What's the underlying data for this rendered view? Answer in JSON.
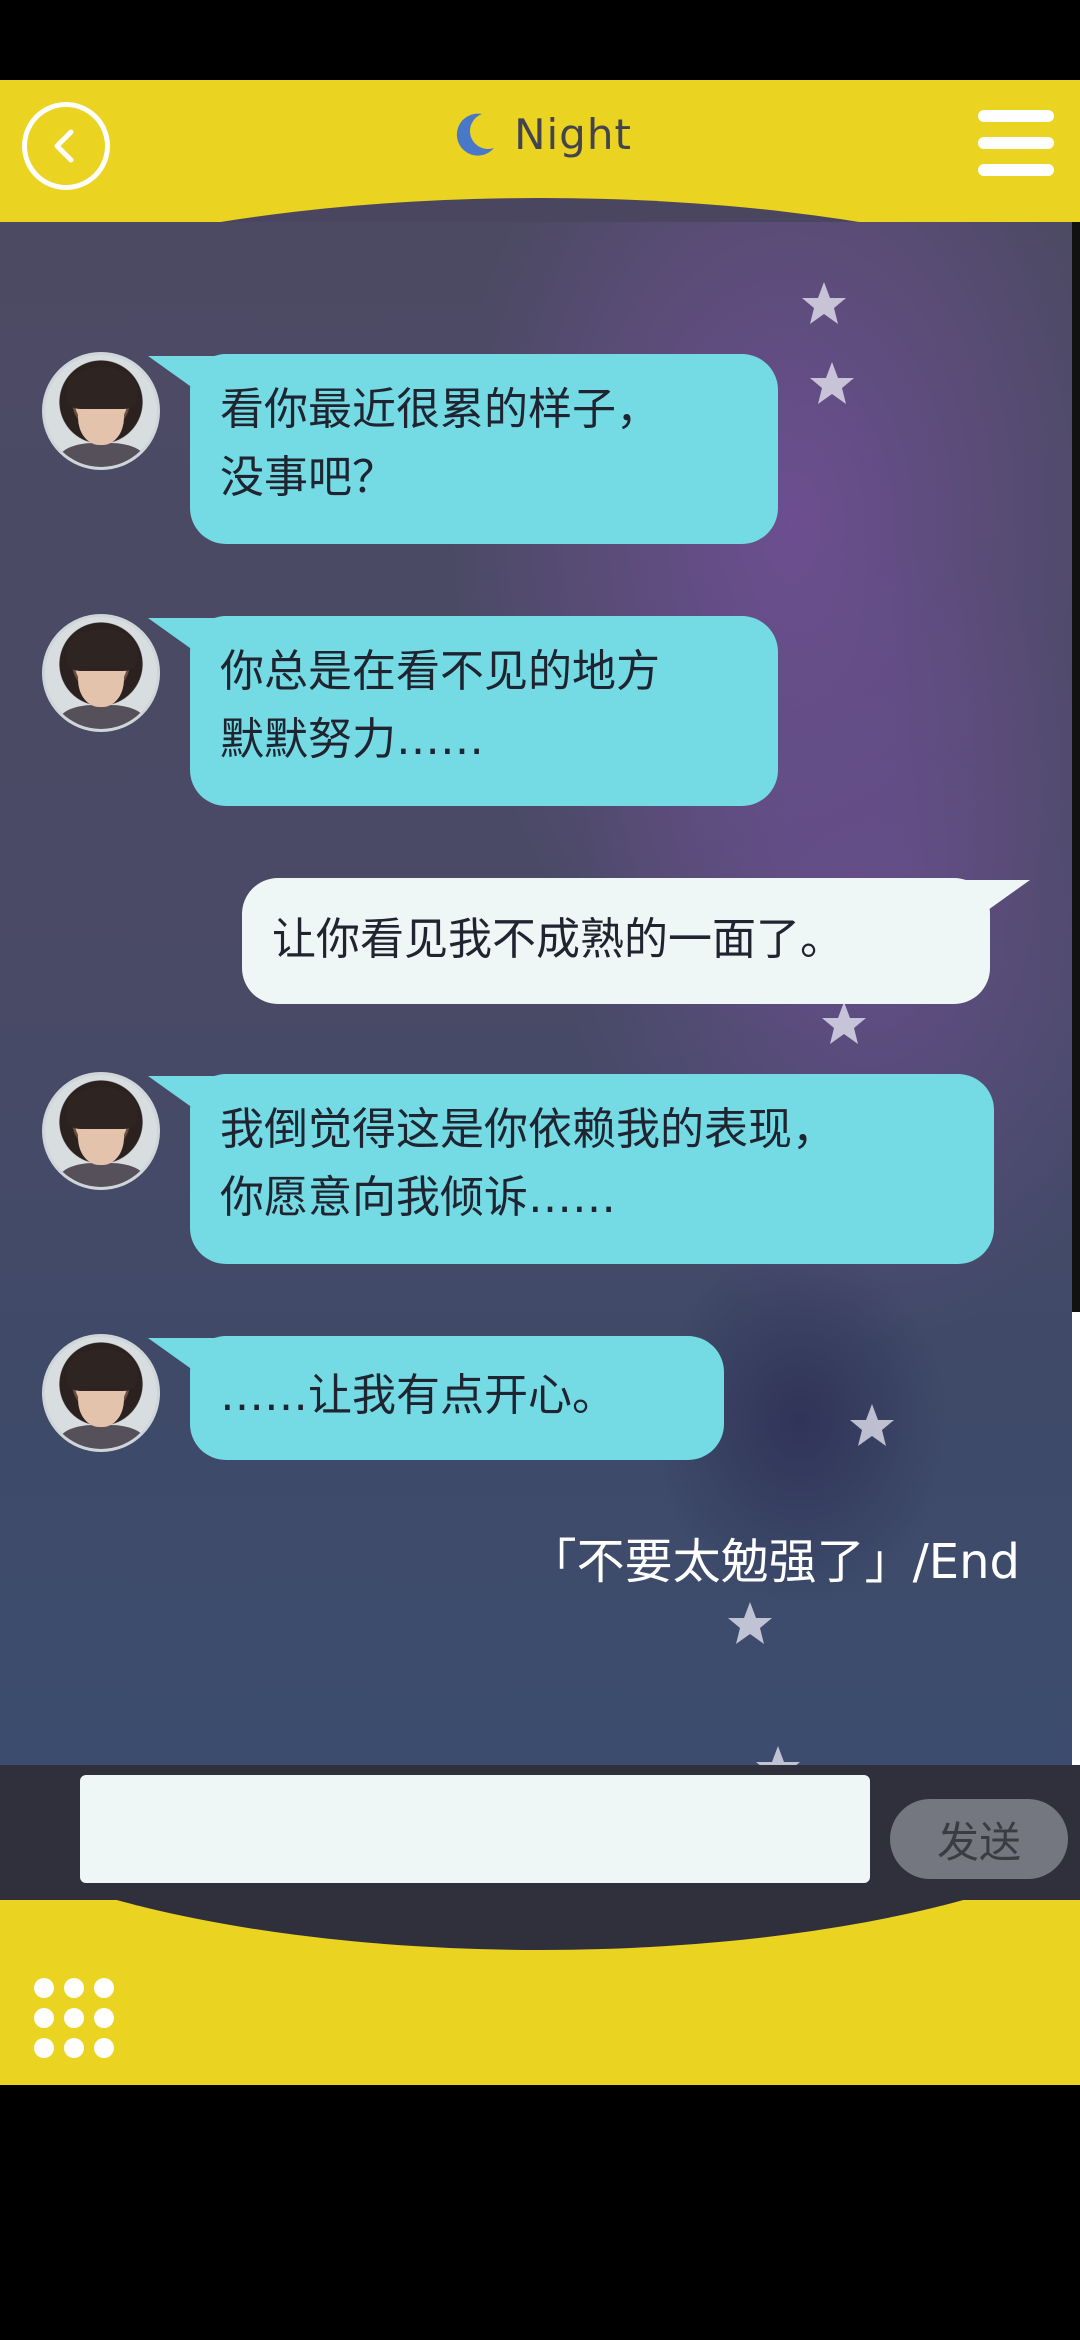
{
  "header": {
    "title": "Night",
    "back_icon": "back-arrow-icon",
    "menu_icon": "hamburger-menu-icon",
    "title_icon": "crescent-moon-icon"
  },
  "messages": [
    {
      "sender": "other",
      "lines": [
        "看你最近很累的样子，",
        "没事吧？"
      ]
    },
    {
      "sender": "other",
      "lines": [
        "你总是在看不见的地方",
        "默默努力……"
      ]
    },
    {
      "sender": "self",
      "lines": [
        "让你看见我不成熟的一面了。"
      ]
    },
    {
      "sender": "other",
      "lines": [
        "我倒觉得这是你依赖我的表现，",
        "你愿意向我倾诉……"
      ]
    },
    {
      "sender": "other",
      "lines": [
        "……让我有点开心。"
      ]
    }
  ],
  "end_text": "「不要太勉强了」/End",
  "composer": {
    "input_value": "",
    "send_label": "发送"
  },
  "footer": {
    "apps_icon": "apps-grid-icon"
  },
  "colors": {
    "accent_yellow": "#EAD321",
    "bubble_other": "#74DAE3",
    "bubble_self": "#EEF7F5"
  }
}
